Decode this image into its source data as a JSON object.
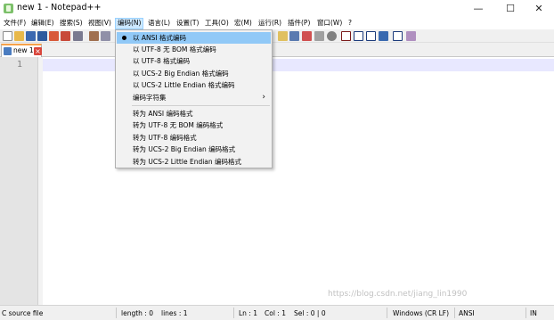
{
  "window": {
    "title": "new 1 - Notepad++"
  },
  "menubar": [
    {
      "label": "文件(F)"
    },
    {
      "label": "编辑(E)"
    },
    {
      "label": "搜索(S)"
    },
    {
      "label": "视图(V)"
    },
    {
      "label": "编码(N)"
    },
    {
      "label": "语言(L)"
    },
    {
      "label": "设置(T)"
    },
    {
      "label": "工具(O)"
    },
    {
      "label": "宏(M)"
    },
    {
      "label": "运行(R)"
    },
    {
      "label": "插件(P)"
    },
    {
      "label": "窗口(W)"
    },
    {
      "label": "?"
    }
  ],
  "encoding_menu": {
    "items": [
      {
        "label": "以 ANSI 格式编码",
        "checked": true
      },
      {
        "label": "以 UTF-8 无 BOM 格式编码"
      },
      {
        "label": "以 UTF-8 格式编码"
      },
      {
        "label": "以 UCS-2 Big Endian 格式编码"
      },
      {
        "label": "以 UCS-2 Little Endian 格式编码"
      },
      {
        "label": "编码字符集",
        "submenu_arrow": "›"
      },
      {
        "label": "转为 ANSI 编码格式"
      },
      {
        "label": "转为 UTF-8 无 BOM 编码格式"
      },
      {
        "label": "转为 UTF-8 编码格式"
      },
      {
        "label": "转为 UCS-2 Big Endian 编码格式"
      },
      {
        "label": "转为 UCS-2 Little Endian 编码格式"
      }
    ]
  },
  "tabs": [
    {
      "label": "new 1"
    }
  ],
  "editor": {
    "line_numbers": [
      "1"
    ]
  },
  "statusbar": {
    "file_type": "C source file",
    "length": "length : 0",
    "lines": "lines : 1",
    "ln": "Ln : 1",
    "col": "Col : 1",
    "sel": "Sel : 0 | 0",
    "eol": "Windows (CR LF)",
    "encoding": "ANSI",
    "mode": "IN"
  },
  "watermark": "https://blog.csdn.net/jiang_lin1990",
  "colors": {
    "menu_highlight": "#91c9f7",
    "active_tab_border": "#f7a24a",
    "current_line": "#e8e8ff",
    "gutter": "#e4e4e4"
  }
}
